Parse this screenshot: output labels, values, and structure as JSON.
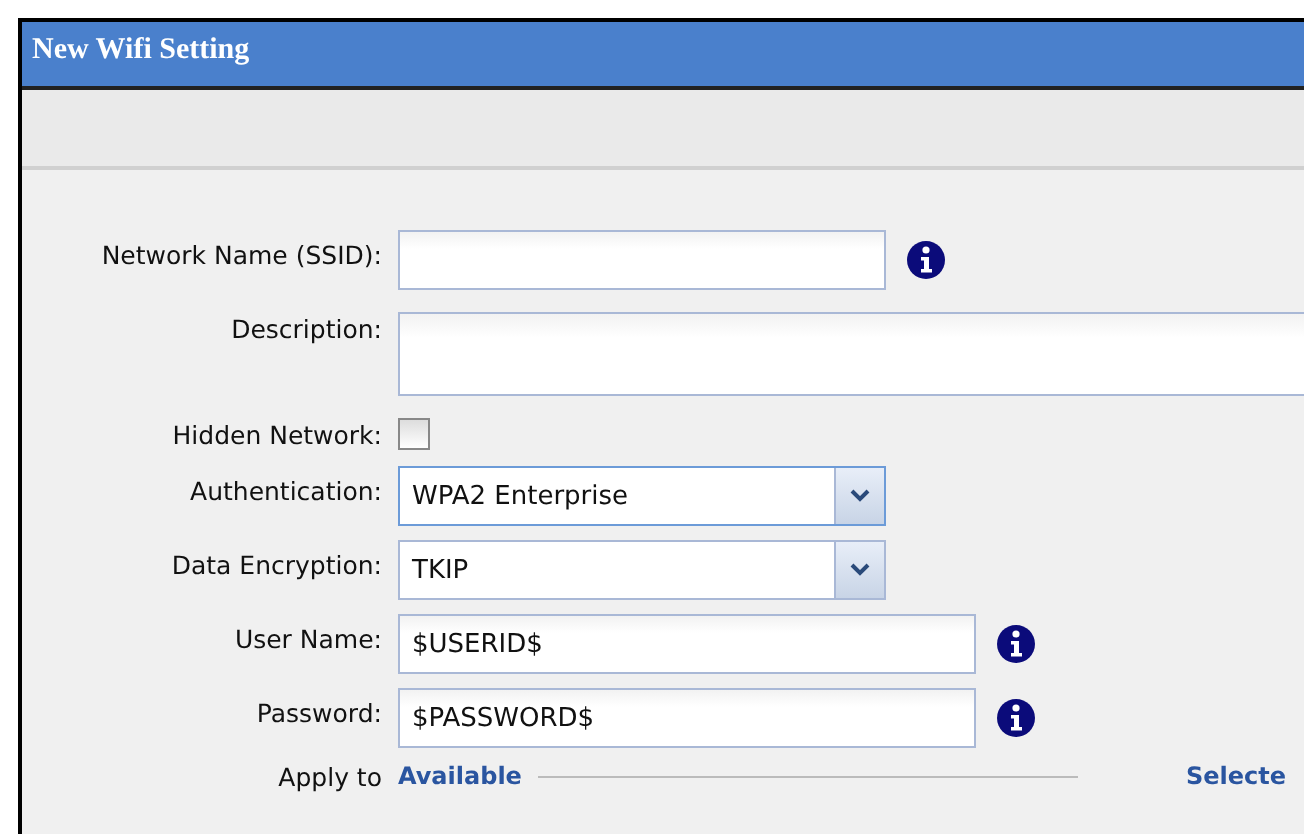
{
  "window": {
    "title": "New Wifi Setting"
  },
  "fields": [
    {
      "kind": "text",
      "label": "Network Name (SSID):",
      "info": true
    },
    {
      "kind": "textarea",
      "label": "Description:"
    },
    {
      "kind": "checkbox",
      "label": "Hidden Network:",
      "checked": false
    },
    {
      "kind": "select",
      "label": "Authentication:",
      "value": "WPA2 Enterprise",
      "focused": true
    },
    {
      "kind": "select",
      "label": "Data Encryption:",
      "value": "TKIP",
      "focused": false
    },
    {
      "kind": "credential",
      "label": "User Name:",
      "value": "$USERID$",
      "info": true
    },
    {
      "kind": "credential",
      "label": "Password:",
      "value": "$PASSWORD$",
      "info": true
    }
  ],
  "apply_to": {
    "label": "Apply to",
    "available": "Available",
    "selected": "Selecte"
  }
}
